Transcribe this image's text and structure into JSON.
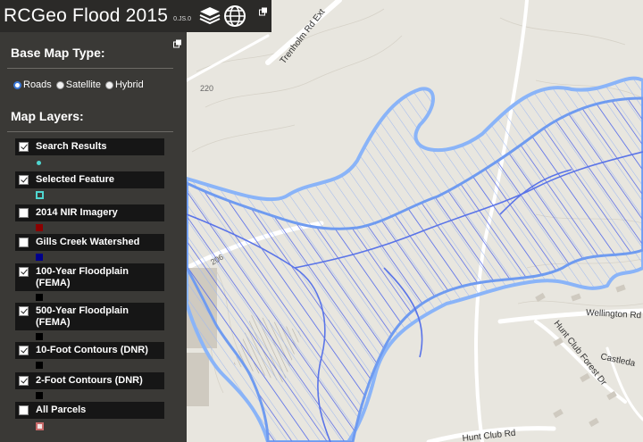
{
  "app": {
    "title": "RCGeo Flood 2015",
    "version": "0.JS.0"
  },
  "toolbar": {
    "icons": [
      "layers-icon",
      "globe-icon",
      "popout-icon"
    ]
  },
  "panel": {
    "basemap_heading": "Base Map Type:",
    "basemap_options": [
      {
        "label": "Roads",
        "selected": true
      },
      {
        "label": "Satellite",
        "selected": false
      },
      {
        "label": "Hybrid",
        "selected": false
      }
    ],
    "layers_heading": "Map Layers:",
    "layers": [
      {
        "label": "Search Results",
        "checked": true,
        "swatch": "cyan-dot"
      },
      {
        "label": "Selected Feature",
        "checked": true,
        "swatch": "cyan-square-outline"
      },
      {
        "label": "2014 NIR Imagery",
        "checked": false,
        "swatch": "#8b0000"
      },
      {
        "label": "Gills Creek Watershed",
        "checked": false,
        "swatch": "#00008b"
      },
      {
        "label": "100-Year Floodplain (FEMA)",
        "checked": true,
        "swatch": "#000000"
      },
      {
        "label": "500-Year Floodplain (FEMA)",
        "checked": true,
        "swatch": "#000000"
      },
      {
        "label": "10-Foot Contours (DNR)",
        "checked": true,
        "swatch": "#000000"
      },
      {
        "label": "2-Foot Contours (DNR)",
        "checked": true,
        "swatch": "#000000"
      },
      {
        "label": "All Parcels",
        "checked": false,
        "swatch": "red-square-outline"
      }
    ]
  },
  "map": {
    "labels": {
      "trenholm": "Trenholm Rd Ext",
      "route220": "220",
      "route206": "206",
      "wellington": "Wellington Rd",
      "huntclubforest": "Hunt Club Forest Dr",
      "castleda": "Castleda",
      "huntclubrd": "Hunt Club Rd"
    },
    "colors": {
      "flood_outline": "#8ab4f8",
      "hatch": "#4a5fe8",
      "land": "#e8e6df",
      "road": "#ffffff"
    }
  }
}
